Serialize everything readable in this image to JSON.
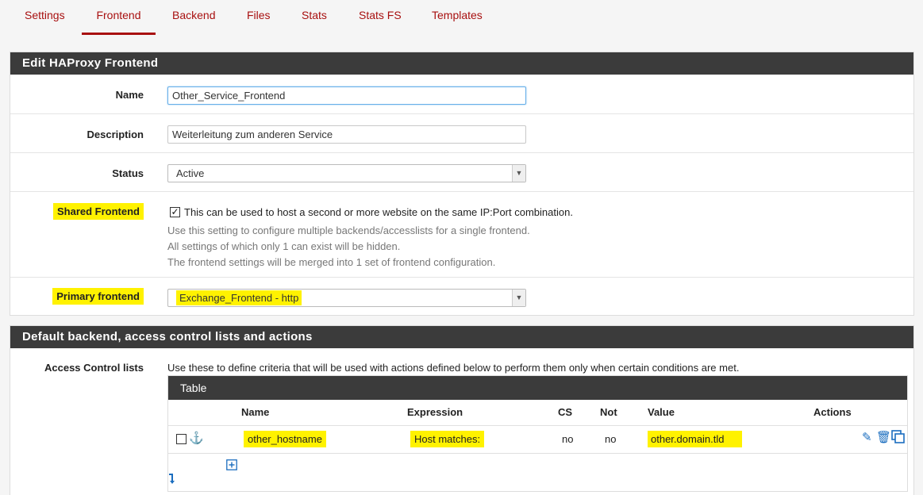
{
  "tabs": [
    "Settings",
    "Frontend",
    "Backend",
    "Files",
    "Stats",
    "Stats FS",
    "Templates"
  ],
  "panel1": {
    "title": "Edit HAProxy Frontend",
    "name_label": "Name",
    "name_value": "Other_Service_Frontend",
    "description_label": "Description",
    "description_value": "Weiterleitung zum anderen Service",
    "status_label": "Status",
    "status_value": "Active",
    "shared_label": "Shared Frontend",
    "shared_checked": "✓",
    "shared_text": "This can be used to host a second or more website on the same IP:Port combination.",
    "shared_help": [
      "Use this setting to configure multiple backends/accesslists for a single frontend.",
      "All settings of which only 1 can exist will be hidden.",
      "The frontend settings will be merged into 1 set of frontend configuration."
    ],
    "primary_label": "Primary frontend",
    "primary_value": "Exchange_Frontend - http"
  },
  "panel2": {
    "title": "Default backend, access control lists and actions",
    "acl_label": "Access Control lists",
    "acl_help": "Use these to define criteria that will be used with actions defined below to perform them only when certain conditions are met.",
    "table_title": "Table",
    "headers": {
      "name": "Name",
      "expression": "Expression",
      "cs": "CS",
      "not": "Not",
      "value": "Value",
      "actions": "Actions"
    },
    "rows": [
      {
        "name": "other_hostname",
        "expression": "Host matches:",
        "cs": "no",
        "not": "no",
        "value": "other.domain.tld"
      }
    ]
  },
  "colors": {
    "tab_red": "#a81010",
    "header_dark": "#3b3b3b",
    "highlight": "#fff200",
    "icon_blue": "#1a6dbf"
  },
  "icons": [
    "anchor-icon",
    "edit-icon",
    "trash-icon",
    "copy-icon",
    "add-icon",
    "move-down-icon"
  ]
}
